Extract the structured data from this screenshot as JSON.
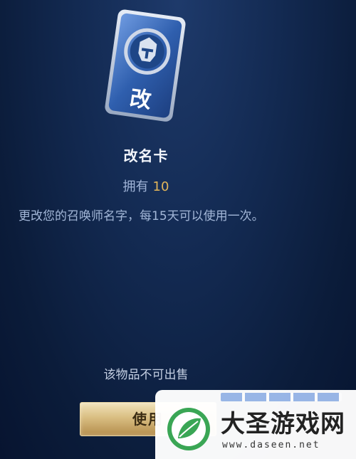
{
  "item": {
    "name": "改名卡",
    "card_glyph": "改",
    "owned_label": "拥有",
    "owned_count": "10",
    "description": "更改您的召唤师名字，每15天可以使用一次。",
    "sell_notice": "该物品不可出售"
  },
  "actions": {
    "use_label": "使用"
  },
  "watermark": {
    "title": "大圣游戏网",
    "url": "www.daseen.net"
  },
  "colors": {
    "background": "#132a52",
    "count_accent": "#e2b55a",
    "button_gold": "#d9be82",
    "card_blue": "#2f5fae"
  },
  "icons": {
    "card_emblem": "knight-helmet-icon",
    "watermark_logo": "leaf-logo-icon"
  }
}
